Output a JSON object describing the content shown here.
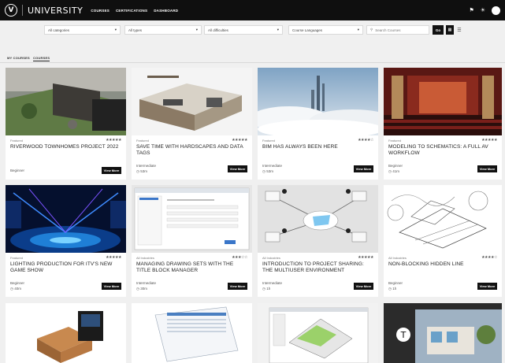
{
  "nav": {
    "logo": "V",
    "brand": "UNIVERSITY",
    "links": [
      "COURSES",
      "CERTIFICATIONS",
      "DASHBOARD"
    ]
  },
  "filters": {
    "categories": "All categories",
    "types": "All types",
    "difficulties": "All difficulties",
    "languages": "Course Languages",
    "search_placeholder": "Search Courses",
    "go_label": "Go"
  },
  "tabs": [
    "MY COURSES",
    "COURSES"
  ],
  "view_more_label": "View More",
  "courses": [
    {
      "category": "Featured",
      "title": "RIVERWOOD TOWNHOMES PROJECT 2022",
      "level": "Beginner",
      "duration": ""
    },
    {
      "category": "Featured",
      "title": "SAVE TIME WITH HARDSCAPES AND DATA TAGS",
      "level": "Intermediate",
      "duration": "53m"
    },
    {
      "category": "Featured",
      "title": "BIM HAS ALWAYS BEEN HERE",
      "level": "Intermediate",
      "duration": "53m"
    },
    {
      "category": "Featured",
      "title": "MODELING TO SCHEMATICS: A FULL AV WORKFLOW",
      "level": "Beginner",
      "duration": "41m"
    },
    {
      "category": "Featured",
      "title": "LIGHTING PRODUCTION FOR ITV'S NEW GAME SHOW",
      "level": "Beginner",
      "duration": "40m"
    },
    {
      "category": "All Industries",
      "title": "MANAGING DRAWING SETS WITH THE TITLE BLOCK MANAGER",
      "level": "Intermediate",
      "duration": "30m"
    },
    {
      "category": "All Industries",
      "title": "INTRODUCTION TO PROJECT SHARING: THE MULTIUSER ENVIRONMENT",
      "level": "Intermediate",
      "duration": "1h"
    },
    {
      "category": "All Industries",
      "title": "NON-BLOCKING HIDDEN LINE",
      "level": "Beginner",
      "duration": "1h"
    }
  ]
}
